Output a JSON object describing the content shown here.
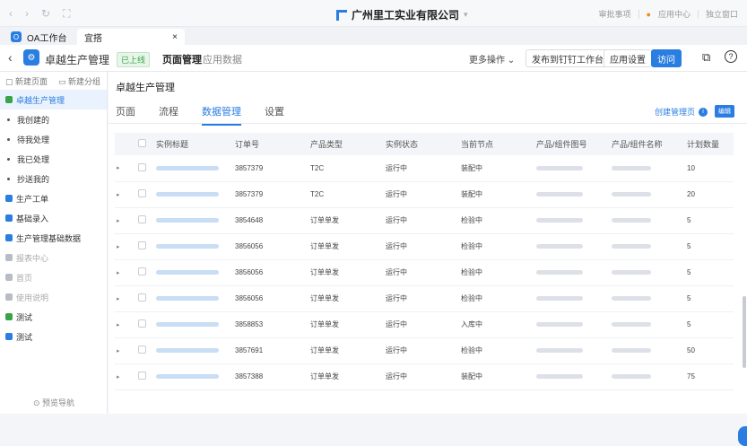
{
  "window": {
    "nav_icons": [
      "‹",
      "›",
      "↻",
      "⛶"
    ],
    "company": "广州里工实业有限公司",
    "right_items": [
      "审批事项",
      "应用中心",
      "独立窗口"
    ]
  },
  "tabs": [
    {
      "label": "OA工作台",
      "badge": "O"
    },
    {
      "label": "宜搭",
      "close": "×"
    }
  ],
  "header": {
    "back_icon": "‹",
    "app_icon": "⚙",
    "app_name": "卓越生产管理",
    "status": "已上线",
    "tabs": [
      "页面管理",
      "应用数据"
    ],
    "more": "更多操作 ⌄",
    "btn_publish": "发布到钉钉工作台",
    "btn_settings": "应用设置",
    "btn_visit": "访问",
    "icon_external": "⧉",
    "icon_help": "?"
  },
  "sidebar": {
    "actions": [
      "新建页面",
      "新建分组"
    ],
    "items": [
      {
        "label": "卓越生产管理",
        "kind": "active",
        "color": "#3aa34a"
      },
      {
        "label": "我创建的",
        "kind": "sub"
      },
      {
        "label": "待我处理",
        "kind": "sub"
      },
      {
        "label": "我已处理",
        "kind": "sub"
      },
      {
        "label": "抄送我的",
        "kind": "sub"
      },
      {
        "label": "生产工单",
        "kind": "icon",
        "color": "#2a7de1"
      },
      {
        "label": "基础录入",
        "kind": "icon",
        "color": "#2a7de1"
      },
      {
        "label": "生产管理基础数据",
        "kind": "icon",
        "color": "#2a7de1"
      },
      {
        "label": "报表中心",
        "kind": "dim",
        "color": "#b8bcc4"
      },
      {
        "label": "首页",
        "kind": "dim",
        "color": "#b8bcc4"
      },
      {
        "label": "使用说明",
        "kind": "dim",
        "color": "#b8bcc4"
      },
      {
        "label": "测试",
        "kind": "icon",
        "color": "#3aa34a"
      },
      {
        "label": "测试",
        "kind": "icon",
        "color": "#2a7de1"
      }
    ],
    "footer": "⊙ 预览导航"
  },
  "content": {
    "title": "卓越生产管理",
    "subtabs": [
      "页面",
      "流程",
      "数据管理",
      "设置"
    ],
    "active_subtab": 2,
    "create_link": "创建管理页",
    "edit_btn": "编辑"
  },
  "table": {
    "columns": [
      "实例标题",
      "订单号",
      "产品类型",
      "实例状态",
      "当前节点",
      "产品/组件图号",
      "产品/组件名称",
      "计划数量"
    ],
    "rows": [
      {
        "order": "3857379",
        "type": "T2C",
        "status": "运行中",
        "node": "装配中",
        "qty": "10"
      },
      {
        "order": "3857379",
        "type": "T2C",
        "status": "运行中",
        "node": "装配中",
        "qty": "20"
      },
      {
        "order": "3854648",
        "type": "订单单发",
        "status": "运行中",
        "node": "检验中",
        "qty": "5"
      },
      {
        "order": "3856056",
        "type": "订单单发",
        "status": "运行中",
        "node": "检验中",
        "qty": "5"
      },
      {
        "order": "3856056",
        "type": "订单单发",
        "status": "运行中",
        "node": "检验中",
        "qty": "5"
      },
      {
        "order": "3856056",
        "type": "订单单发",
        "status": "运行中",
        "node": "检验中",
        "qty": "5"
      },
      {
        "order": "3858853",
        "type": "订单单发",
        "status": "运行中",
        "node": "入库中",
        "qty": "5"
      },
      {
        "order": "3857691",
        "type": "订单单发",
        "status": "运行中",
        "node": "检验中",
        "qty": "50"
      },
      {
        "order": "3857388",
        "type": "订单单发",
        "status": "运行中",
        "node": "装配中",
        "qty": "75"
      }
    ]
  }
}
